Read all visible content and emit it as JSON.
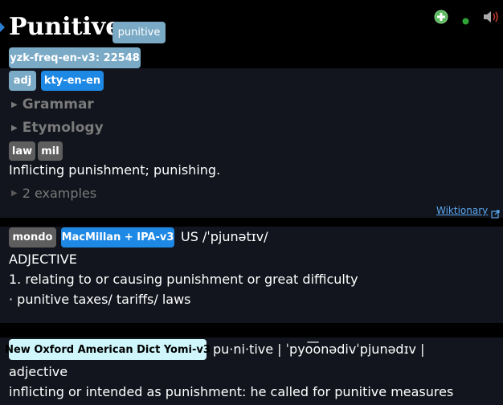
{
  "colors": {
    "background": "#000000",
    "panel": "#12151d",
    "tag_light_blue": "#7aaac5",
    "tag_blue": "#1e88e5",
    "tag_gray": "#5e5e5e",
    "tag_cyan": "#cff6fb",
    "link": "#5aa7f0",
    "add_green": "#59b95c",
    "dot_green": "#2ea336",
    "speaker_red": "#c0392b"
  },
  "headword": {
    "term": "Punitive",
    "reading_tag": "punitive",
    "frequency_tag": "yzk-freq-en-v3: 22548"
  },
  "icons": {
    "add": "plus-circle-icon",
    "status": "green-dot-icon",
    "audio": "speaker-icon",
    "marker": "triangle-marker-icon",
    "external": "external-link-icon"
  },
  "entry1": {
    "tags": [
      "adj",
      "kty-en-en"
    ],
    "grammar_label": "Grammar",
    "etymology_label": "Etymology",
    "sense_tags": [
      "law",
      "mil"
    ],
    "definition": "Inflicting punishment; punishing.",
    "examples_label": "2 examples",
    "source_link": "Wiktionary"
  },
  "entry2": {
    "tags": [
      "mondo",
      "MacMillan + IPA-v3"
    ],
    "pronunciation": "US /ˈpjunətɪv/",
    "pos": "ADJECTIVE",
    "definition": "1. relating to or causing punishment or great difficulty",
    "example": "· punitive taxes/ tariffs/ laws"
  },
  "entry3": {
    "tag": "New Oxford American Dict Yomi-v3",
    "pronunciation": "pu·ni·tive | ˈpyo͞onədivˈpjunədɪv |",
    "pos": "adjective",
    "definition": "inflicting or intended as punishment: he called for punitive measures"
  }
}
